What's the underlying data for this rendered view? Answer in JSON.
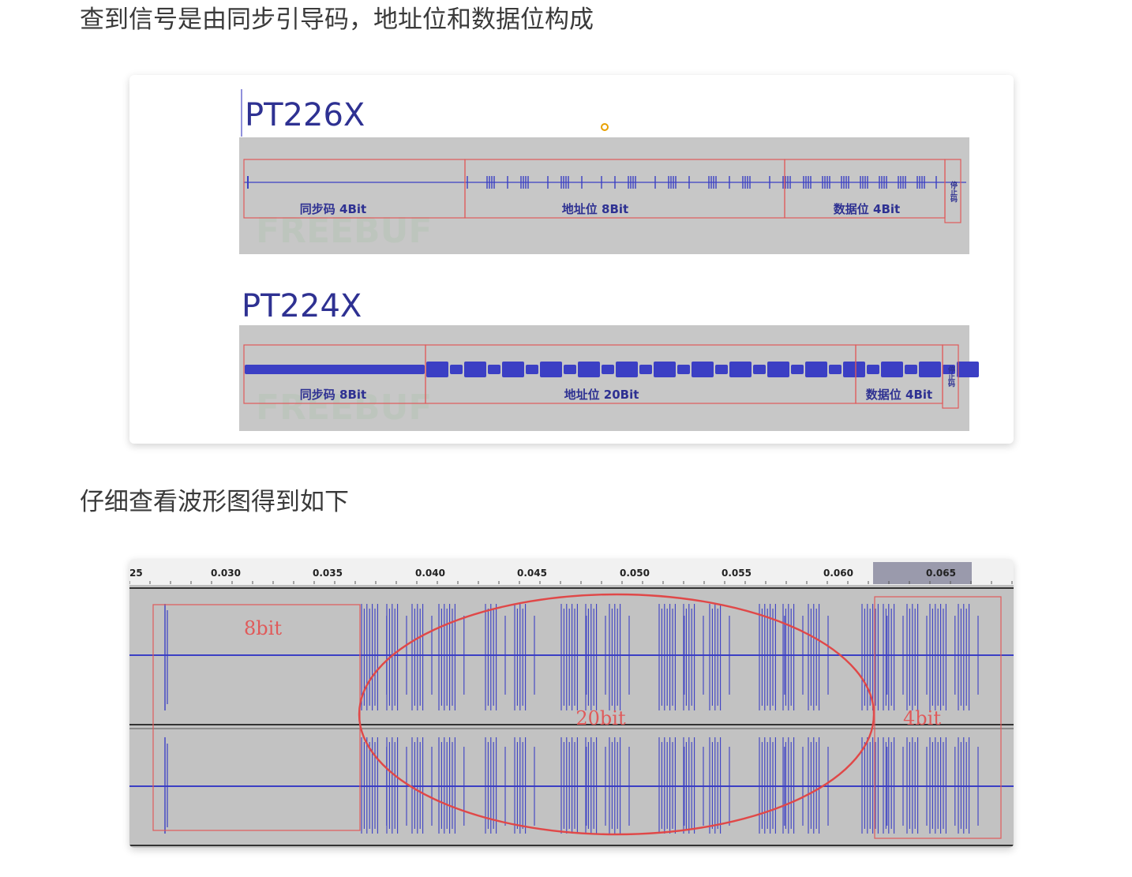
{
  "article": {
    "para1": "查到信号是由同步引导码，地址位和数据位构成",
    "para2": "仔细查看波形图得到如下"
  },
  "figure1": {
    "pt226x": {
      "title": "PT226X",
      "labels": {
        "sync": "同步码 4Bit",
        "addr": "地址位 8Bit",
        "data": "数据位 4Bit",
        "stop": "停止码"
      }
    },
    "pt224x": {
      "title": "PT224X",
      "labels": {
        "sync": "同步码 8Bit",
        "addr": "地址位 20Bit",
        "data": "数据位 4Bit",
        "stop": "停止码"
      }
    },
    "watermark": "FREEBUF"
  },
  "figure2": {
    "ruler_ticks": [
      "25",
      "0.030",
      "0.035",
      "0.040",
      "0.045",
      "0.050",
      "0.055",
      "0.060",
      "0.065"
    ],
    "annotations": {
      "sync": "8bit",
      "addr": "20bit",
      "data": "4bit"
    }
  },
  "colors": {
    "wave": "#3b3fc4",
    "box": "#e05a5a",
    "panel": "#c7c7c7",
    "title": "#2e3192"
  }
}
